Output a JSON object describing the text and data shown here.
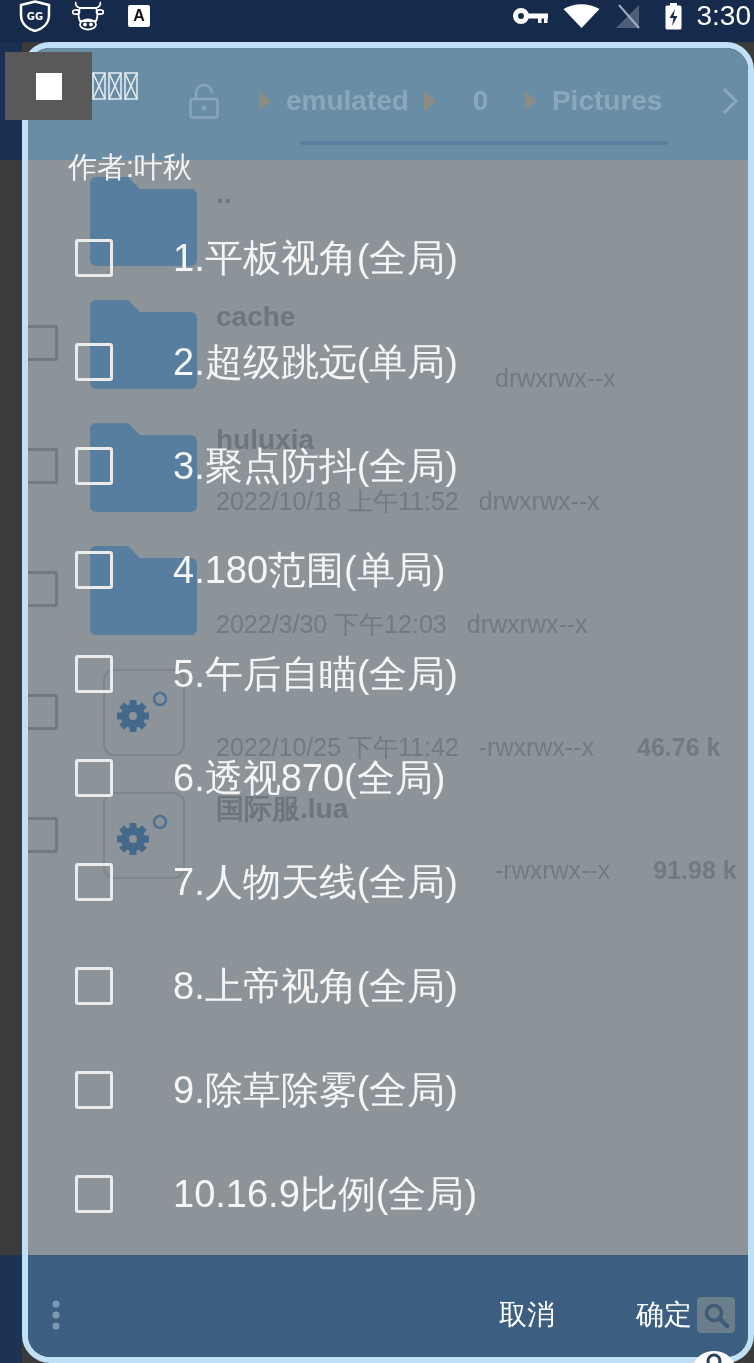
{
  "status_bar": {
    "gg_badge": "GG",
    "app_badge": "A",
    "time": "3:30"
  },
  "file_manager": {
    "breadcrumb": [
      "emulated",
      "0",
      "Pictures"
    ],
    "file_list": {
      "parent_row": {
        "kind": "folder",
        "name": ".."
      },
      "rows": [
        {
          "kind": "folder",
          "name": "cache",
          "checked": false,
          "permissions": "drwxrwx--x"
        },
        {
          "kind": "folder",
          "name": "huluxia",
          "checked": false,
          "modified": "2022/10/18 上午11:52",
          "permissions": "drwxrwx--x"
        },
        {
          "kind": "folder",
          "checked": false,
          "modified": "2022/3/30 下午12:03",
          "permissions": "drwxrwx--x"
        },
        {
          "kind": "script",
          "checked": false,
          "modified": "2022/10/25 下午11:42",
          "permissions": "-rwxrwx--x",
          "size": "46.76 k"
        },
        {
          "kind": "script",
          "name": "国际服.lua",
          "checked": false,
          "permissions": "-rwxrwx--x",
          "size": "91.98 k"
        }
      ]
    }
  },
  "dialog": {
    "message": "作者:叶秋",
    "options": [
      {
        "label": "1.平板视角(全局)",
        "checked": false
      },
      {
        "label": "2.超级跳远(单局)",
        "checked": false
      },
      {
        "label": "3.聚点防抖(全局)",
        "checked": false
      },
      {
        "label": "4.180范围(单局)",
        "checked": false
      },
      {
        "label": "5.午后自瞄(全局)",
        "checked": false
      },
      {
        "label": "6.透视870(全局)",
        "checked": false
      },
      {
        "label": "7.人物天线(全局)",
        "checked": false
      },
      {
        "label": "8.上帝视角(全局)",
        "checked": false
      },
      {
        "label": "9.除草除雾(全局)",
        "checked": false
      },
      {
        "label": "10.16.9比例(全局)",
        "checked": false
      }
    ],
    "buttons": [
      "取消",
      "确定"
    ]
  }
}
